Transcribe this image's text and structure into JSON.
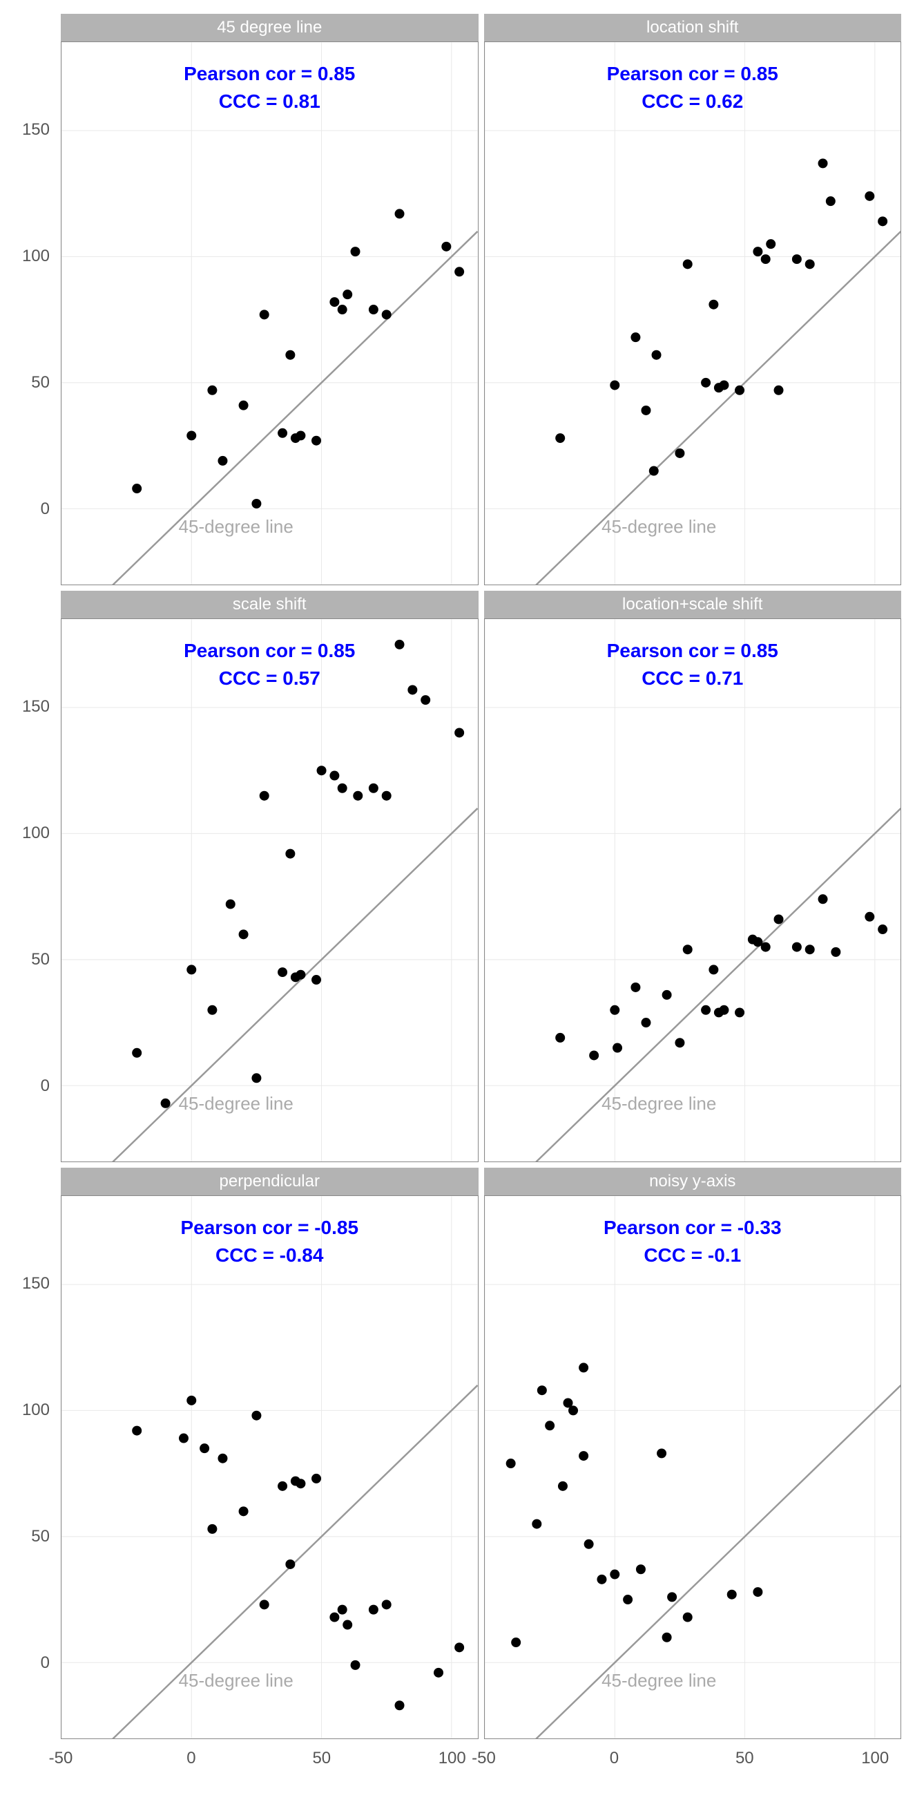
{
  "chart_data": [
    {
      "type": "scatter",
      "title": "45 degree line",
      "xlim": [
        -50,
        110
      ],
      "ylim": [
        -30,
        185
      ],
      "pearson": 0.85,
      "ccc": 0.81,
      "pearson_label": "Pearson cor = 0.85",
      "ccc_label": "CCC = 0.81",
      "ref_label": "45-degree line",
      "xticks": [
        -50,
        0,
        50,
        100
      ],
      "yticks": [
        0,
        50,
        100,
        150
      ],
      "points": [
        {
          "x": -21,
          "y": 8
        },
        {
          "x": 0,
          "y": 29
        },
        {
          "x": 8,
          "y": 47
        },
        {
          "x": 12,
          "y": 19
        },
        {
          "x": 20,
          "y": 41
        },
        {
          "x": 25,
          "y": 2
        },
        {
          "x": 28,
          "y": 77
        },
        {
          "x": 35,
          "y": 30
        },
        {
          "x": 38,
          "y": 61
        },
        {
          "x": 40,
          "y": 28
        },
        {
          "x": 42,
          "y": 29
        },
        {
          "x": 48,
          "y": 27
        },
        {
          "x": 55,
          "y": 82
        },
        {
          "x": 58,
          "y": 79
        },
        {
          "x": 60,
          "y": 85
        },
        {
          "x": 63,
          "y": 102
        },
        {
          "x": 70,
          "y": 79
        },
        {
          "x": 75,
          "y": 77
        },
        {
          "x": 80,
          "y": 117
        },
        {
          "x": 98,
          "y": 104
        },
        {
          "x": 103,
          "y": 94
        }
      ]
    },
    {
      "type": "scatter",
      "title": "location shift",
      "xlim": [
        -50,
        110
      ],
      "ylim": [
        -30,
        185
      ],
      "pearson": 0.85,
      "ccc": 0.62,
      "pearson_label": "Pearson cor = 0.85",
      "ccc_label": "CCC = 0.62",
      "ref_label": "45-degree line",
      "xticks": [
        -50,
        0,
        50,
        100
      ],
      "yticks": [
        0,
        50,
        100,
        150
      ],
      "points": [
        {
          "x": -21,
          "y": 28
        },
        {
          "x": 0,
          "y": 49
        },
        {
          "x": 8,
          "y": 68
        },
        {
          "x": 12,
          "y": 39
        },
        {
          "x": 15,
          "y": 15
        },
        {
          "x": 16,
          "y": 61
        },
        {
          "x": 25,
          "y": 22
        },
        {
          "x": 28,
          "y": 97
        },
        {
          "x": 35,
          "y": 50
        },
        {
          "x": 38,
          "y": 81
        },
        {
          "x": 40,
          "y": 48
        },
        {
          "x": 42,
          "y": 49
        },
        {
          "x": 48,
          "y": 47
        },
        {
          "x": 55,
          "y": 102
        },
        {
          "x": 58,
          "y": 99
        },
        {
          "x": 60,
          "y": 105
        },
        {
          "x": 63,
          "y": 47
        },
        {
          "x": 70,
          "y": 99
        },
        {
          "x": 75,
          "y": 97
        },
        {
          "x": 80,
          "y": 137
        },
        {
          "x": 83,
          "y": 122
        },
        {
          "x": 98,
          "y": 124
        },
        {
          "x": 103,
          "y": 114
        }
      ]
    },
    {
      "type": "scatter",
      "title": "scale shift",
      "xlim": [
        -50,
        110
      ],
      "ylim": [
        -30,
        185
      ],
      "pearson": 0.85,
      "ccc": 0.57,
      "pearson_label": "Pearson cor = 0.85",
      "ccc_label": "CCC = 0.57",
      "ref_label": "45-degree line",
      "xticks": [
        -50,
        0,
        50,
        100
      ],
      "yticks": [
        0,
        50,
        100,
        150
      ],
      "points": [
        {
          "x": -21,
          "y": 13
        },
        {
          "x": -10,
          "y": -7
        },
        {
          "x": 0,
          "y": 46
        },
        {
          "x": 8,
          "y": 30
        },
        {
          "x": 15,
          "y": 72
        },
        {
          "x": 20,
          "y": 60
        },
        {
          "x": 25,
          "y": 3
        },
        {
          "x": 28,
          "y": 115
        },
        {
          "x": 35,
          "y": 45
        },
        {
          "x": 38,
          "y": 92
        },
        {
          "x": 40,
          "y": 43
        },
        {
          "x": 42,
          "y": 44
        },
        {
          "x": 48,
          "y": 42
        },
        {
          "x": 50,
          "y": 125
        },
        {
          "x": 55,
          "y": 123
        },
        {
          "x": 58,
          "y": 118
        },
        {
          "x": 64,
          "y": 115
        },
        {
          "x": 70,
          "y": 118
        },
        {
          "x": 75,
          "y": 115
        },
        {
          "x": 80,
          "y": 175
        },
        {
          "x": 85,
          "y": 157
        },
        {
          "x": 90,
          "y": 153
        },
        {
          "x": 103,
          "y": 140
        }
      ]
    },
    {
      "type": "scatter",
      "title": "location+scale shift",
      "xlim": [
        -50,
        110
      ],
      "ylim": [
        -30,
        185
      ],
      "pearson": 0.85,
      "ccc": 0.71,
      "pearson_label": "Pearson cor = 0.85",
      "ccc_label": "CCC = 0.71",
      "ref_label": "45-degree line",
      "xticks": [
        -50,
        0,
        50,
        100
      ],
      "yticks": [
        0,
        50,
        100,
        150
      ],
      "points": [
        {
          "x": -21,
          "y": 19
        },
        {
          "x": -8,
          "y": 12
        },
        {
          "x": 0,
          "y": 30
        },
        {
          "x": 1,
          "y": 15
        },
        {
          "x": 8,
          "y": 39
        },
        {
          "x": 12,
          "y": 25
        },
        {
          "x": 20,
          "y": 36
        },
        {
          "x": 25,
          "y": 17
        },
        {
          "x": 28,
          "y": 54
        },
        {
          "x": 35,
          "y": 30
        },
        {
          "x": 38,
          "y": 46
        },
        {
          "x": 40,
          "y": 29
        },
        {
          "x": 42,
          "y": 30
        },
        {
          "x": 48,
          "y": 29
        },
        {
          "x": 53,
          "y": 58
        },
        {
          "x": 55,
          "y": 57
        },
        {
          "x": 58,
          "y": 55
        },
        {
          "x": 63,
          "y": 66
        },
        {
          "x": 70,
          "y": 55
        },
        {
          "x": 75,
          "y": 54
        },
        {
          "x": 80,
          "y": 74
        },
        {
          "x": 85,
          "y": 53
        },
        {
          "x": 98,
          "y": 67
        },
        {
          "x": 103,
          "y": 62
        }
      ]
    },
    {
      "type": "scatter",
      "title": "perpendicular",
      "xlim": [
        -50,
        110
      ],
      "ylim": [
        -30,
        185
      ],
      "pearson": -0.85,
      "ccc": -0.84,
      "pearson_label": "Pearson cor = -0.85",
      "ccc_label": "CCC = -0.84",
      "ref_label": "45-degree line",
      "xticks": [
        -50,
        0,
        50,
        100
      ],
      "yticks": [
        0,
        50,
        100,
        150
      ],
      "points": [
        {
          "x": -21,
          "y": 92
        },
        {
          "x": -3,
          "y": 89
        },
        {
          "x": 0,
          "y": 104
        },
        {
          "x": 5,
          "y": 85
        },
        {
          "x": 8,
          "y": 53
        },
        {
          "x": 12,
          "y": 81
        },
        {
          "x": 20,
          "y": 60
        },
        {
          "x": 25,
          "y": 98
        },
        {
          "x": 28,
          "y": 23
        },
        {
          "x": 35,
          "y": 70
        },
        {
          "x": 38,
          "y": 39
        },
        {
          "x": 40,
          "y": 72
        },
        {
          "x": 42,
          "y": 71
        },
        {
          "x": 48,
          "y": 73
        },
        {
          "x": 55,
          "y": 18
        },
        {
          "x": 58,
          "y": 21
        },
        {
          "x": 60,
          "y": 15
        },
        {
          "x": 63,
          "y": -1
        },
        {
          "x": 70,
          "y": 21
        },
        {
          "x": 75,
          "y": 23
        },
        {
          "x": 80,
          "y": -17
        },
        {
          "x": 95,
          "y": -4
        },
        {
          "x": 103,
          "y": 6
        }
      ]
    },
    {
      "type": "scatter",
      "title": "noisy y-axis",
      "xlim": [
        -50,
        110
      ],
      "ylim": [
        -30,
        185
      ],
      "pearson": -0.33,
      "ccc": -0.1,
      "pearson_label": "Pearson cor = -0.33",
      "ccc_label": "CCC = -0.1",
      "ref_label": "45-degree line",
      "xticks": [
        -50,
        0,
        50,
        100
      ],
      "yticks": [
        0,
        50,
        100,
        150
      ],
      "points": [
        {
          "x": -40,
          "y": 79
        },
        {
          "x": -38,
          "y": 8
        },
        {
          "x": -30,
          "y": 55
        },
        {
          "x": -28,
          "y": 108
        },
        {
          "x": -25,
          "y": 94
        },
        {
          "x": -20,
          "y": 70
        },
        {
          "x": -18,
          "y": 103
        },
        {
          "x": -16,
          "y": 100
        },
        {
          "x": -12,
          "y": 82
        },
        {
          "x": -12,
          "y": 117
        },
        {
          "x": -10,
          "y": 47
        },
        {
          "x": -5,
          "y": 33
        },
        {
          "x": 0,
          "y": 35
        },
        {
          "x": 5,
          "y": 25
        },
        {
          "x": 10,
          "y": 37
        },
        {
          "x": 18,
          "y": 83
        },
        {
          "x": 20,
          "y": 10
        },
        {
          "x": 22,
          "y": 26
        },
        {
          "x": 28,
          "y": 18
        },
        {
          "x": 45,
          "y": 27
        },
        {
          "x": 55,
          "y": 28
        }
      ]
    }
  ]
}
